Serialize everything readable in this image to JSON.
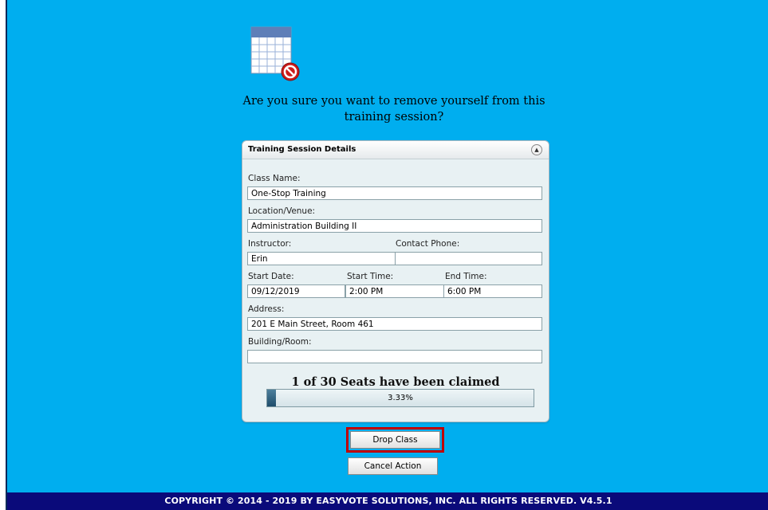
{
  "dialog": {
    "prompt": "Are you sure you want to remove yourself from this training session?"
  },
  "panel": {
    "title": "Training Session Details",
    "labels": {
      "class_name": "Class Name:",
      "location": "Location/Venue:",
      "instructor": "Instructor:",
      "contact_phone": "Contact Phone:",
      "start_date": "Start Date:",
      "start_time": "Start Time:",
      "end_time": "End Time:",
      "address": "Address:",
      "building_room": "Building/Room:"
    },
    "values": {
      "class_name": "One-Stop Training",
      "location": "Administration Building II",
      "instructor": "Erin",
      "contact_phone": "",
      "start_date": "09/12/2019",
      "start_time": "2:00 PM",
      "end_time": "6:00 PM",
      "address": "201 E Main Street, Room 461",
      "building_room": ""
    },
    "seats_text": "1 of 30 Seats have been claimed",
    "progress_fraction": 0.0333,
    "progress_label": "3.33%"
  },
  "actions": {
    "drop_label": "Drop Class",
    "cancel_label": "Cancel Action"
  },
  "footer": {
    "text": "COPYRIGHT © 2014 - 2019 BY EASYVOTE SOLUTIONS, INC. ALL RIGHTS RESERVED. V4.5.1"
  },
  "icons": {
    "calendar": "calendar-remove-icon",
    "collapse": "collapse-up-icon"
  },
  "colors": {
    "page_background": "#00aeef",
    "footer_background": "#0a0a7a",
    "highlight_border": "#c00000"
  }
}
